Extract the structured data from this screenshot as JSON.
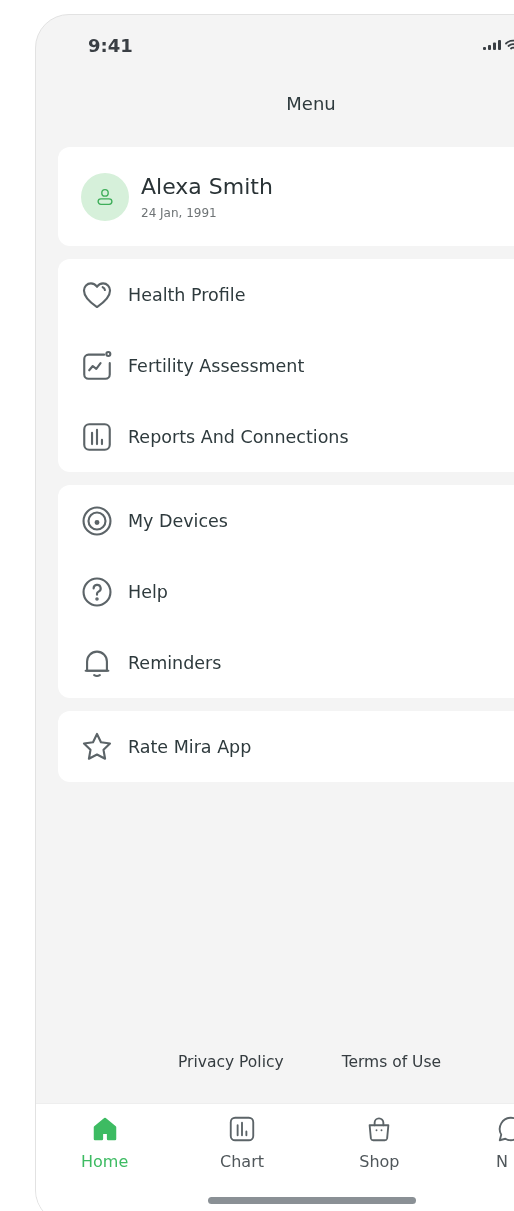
{
  "status_bar": {
    "time": "9:41"
  },
  "header": {
    "title": "Menu"
  },
  "profile": {
    "name": "Alexa Smith",
    "birth_date": "24 Jan, 1991"
  },
  "menu_groups": [
    {
      "items": [
        {
          "label": "Health Profile",
          "kind": "heart"
        },
        {
          "label": "Fertility Assessment",
          "kind": "assessment"
        },
        {
          "label": "Reports And Connections",
          "kind": "reports"
        }
      ]
    },
    {
      "items": [
        {
          "label": "My Devices",
          "kind": "device"
        },
        {
          "label": "Help",
          "kind": "help"
        },
        {
          "label": "Reminders",
          "kind": "bell"
        }
      ]
    },
    {
      "items": [
        {
          "label": "Rate Mira App",
          "kind": "star"
        }
      ]
    }
  ],
  "footer_links": [
    "Privacy Policy",
    "Terms of Use"
  ],
  "tab_bar": [
    {
      "label": "Home",
      "kind": "home",
      "selected": true
    },
    {
      "label": "Chart",
      "kind": "chart",
      "selected": false
    },
    {
      "label": "Shop",
      "kind": "shop",
      "selected": false
    },
    {
      "label": "N",
      "kind": "chat",
      "selected": false
    }
  ]
}
